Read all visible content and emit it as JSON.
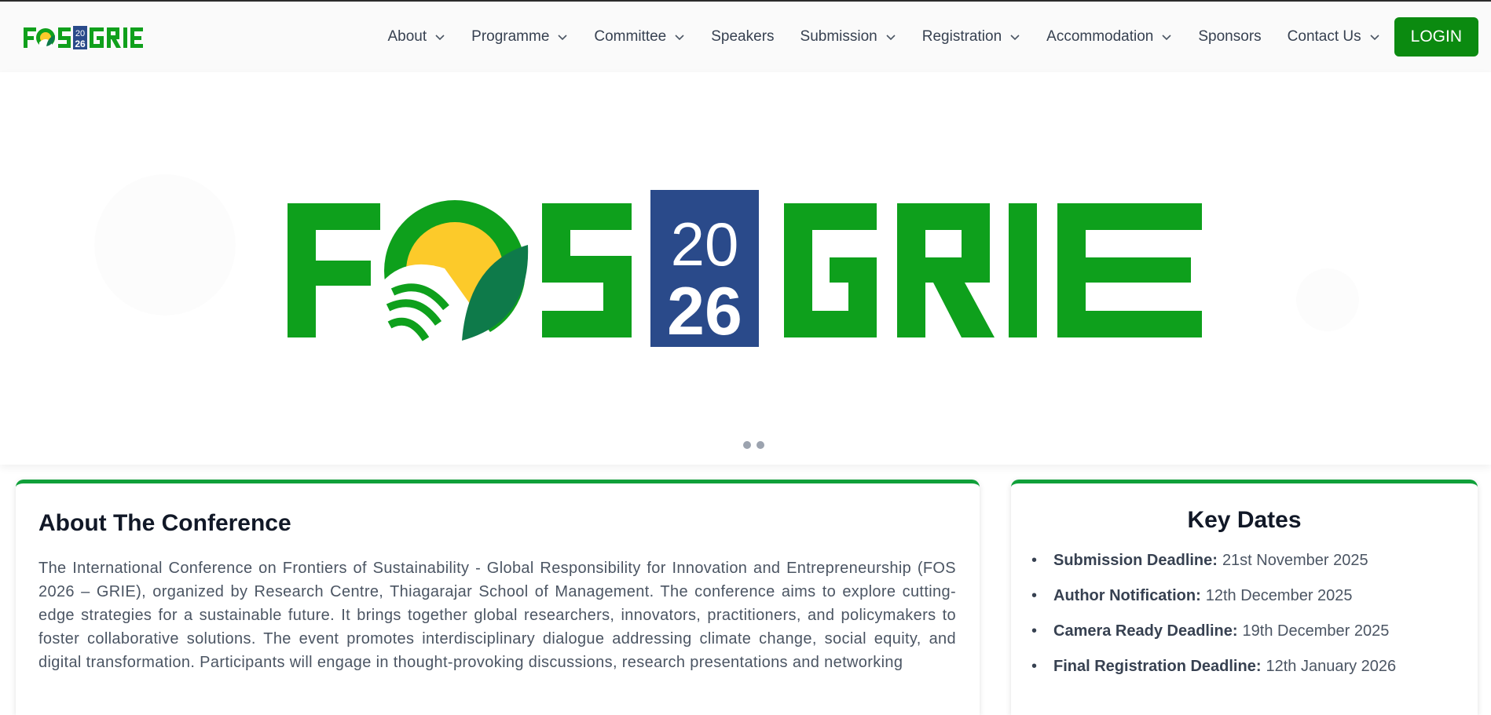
{
  "brand": {
    "logo_text_left": "FOS",
    "logo_year_top": "20",
    "logo_year_bottom": "26",
    "logo_text_right": "GRIE"
  },
  "nav": {
    "items": [
      {
        "label": "About",
        "dropdown": true
      },
      {
        "label": "Programme",
        "dropdown": true
      },
      {
        "label": "Committee",
        "dropdown": true
      },
      {
        "label": "Speakers",
        "dropdown": false
      },
      {
        "label": "Submission",
        "dropdown": true
      },
      {
        "label": "Registration",
        "dropdown": true
      },
      {
        "label": "Accommodation",
        "dropdown": true
      },
      {
        "label": "Sponsors",
        "dropdown": false
      },
      {
        "label": "Contact Us",
        "dropdown": true
      }
    ],
    "login_label": "LOGIN"
  },
  "hero": {
    "logo_text_left": "FOS",
    "logo_year_top": "20",
    "logo_year_bottom": "26",
    "logo_text_right": "GRIE",
    "slides": 2,
    "active_slide": 1
  },
  "about": {
    "title": "About The Conference",
    "body": "The International Conference on Frontiers of Sustainability - Global Responsibility for Innovation and Entrepreneurship (FOS 2026 – GRIE), organized by Research Centre, Thiagarajar School of Management. The conference aims to explore cutting-edge strategies for a sustainable future. It brings together global researchers, innovators, practitioners, and policymakers to foster collaborative solutions. The event promotes interdisciplinary dialogue addressing climate change, social equity, and digital transformation. Participants will engage in thought-provoking discussions, research presentations and networking"
  },
  "key_dates": {
    "title": "Key Dates",
    "items": [
      {
        "label": "Submission Deadline:",
        "value": "21st November 2025"
      },
      {
        "label": "Author Notification:",
        "value": "12th December 2025"
      },
      {
        "label": "Camera Ready Deadline:",
        "value": "19th December 2025"
      },
      {
        "label": "Final Registration Deadline:",
        "value": "12th January 2026"
      }
    ]
  },
  "colors": {
    "brand_green": "#10a01c",
    "login_green": "#0b8a10",
    "year_blue": "#2a4a8a",
    "sun_yellow": "#fcca2a",
    "leaf_green": "#0e7a4a",
    "card_accent": "#10a03a"
  }
}
